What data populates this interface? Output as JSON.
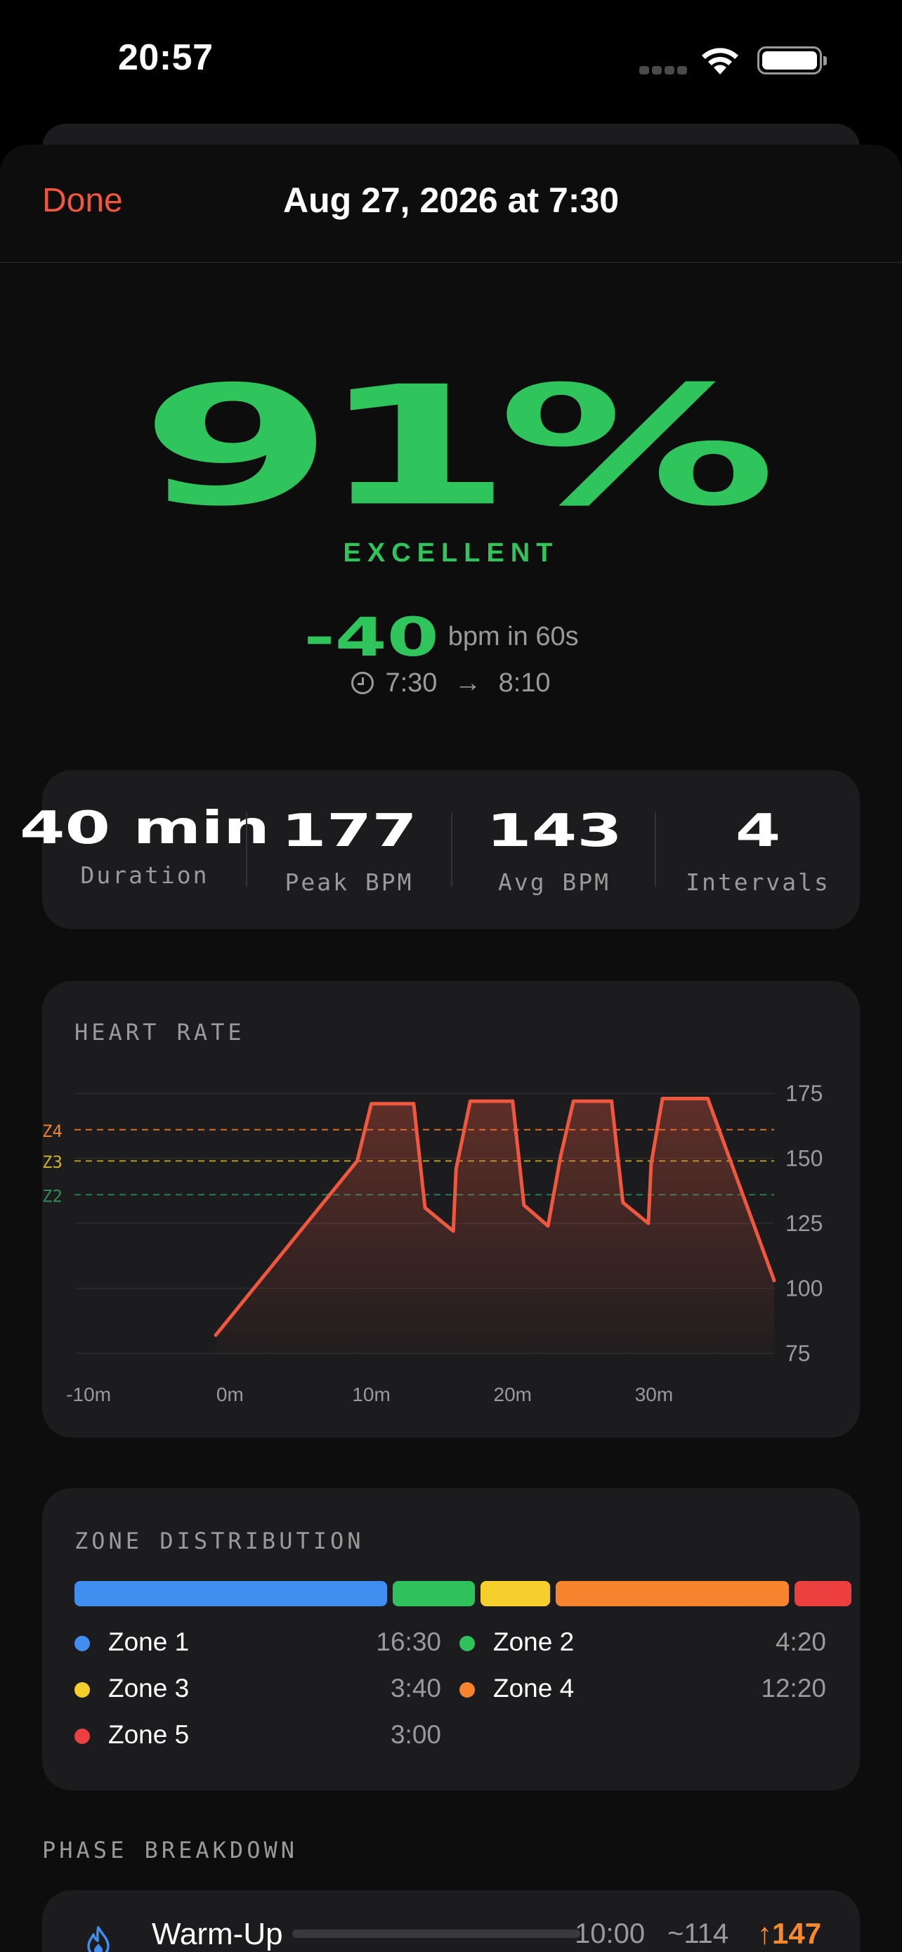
{
  "status_bar": {
    "time": "20:57"
  },
  "nav": {
    "done_label": "Done",
    "title": "Aug 27, 2026 at 7:30"
  },
  "summary": {
    "score": "91%",
    "grade": "EXCELLENT",
    "recovery_value": "-40",
    "recovery_unit": "bpm in 60s",
    "time_start": "7:30",
    "time_arrow": "→",
    "time_end": "8:10"
  },
  "stats": [
    {
      "value": "40 min",
      "label": "Duration"
    },
    {
      "value": "177",
      "label": "Peak BPM"
    },
    {
      "value": "143",
      "label": "Avg BPM"
    },
    {
      "value": "4",
      "label": "Intervals"
    }
  ],
  "heart_rate": {
    "title": "HEART RATE",
    "zone_labels": [
      "Z4",
      "Z3",
      "Z2"
    ],
    "y_ticks": [
      "175",
      "150",
      "125",
      "100",
      "75"
    ],
    "x_ticks": [
      "-10m",
      "0m",
      "10m",
      "20m",
      "30m"
    ],
    "colors": {
      "line": "#f0573f",
      "z4": "#f0822e",
      "z3": "#c9b02a",
      "z2": "#2f8a5a"
    }
  },
  "chart_data": {
    "type": "line",
    "title": "HEART RATE",
    "xlabel": "",
    "ylabel": "",
    "x_unit": "min",
    "ylim": [
      75,
      175
    ],
    "xlim": [
      -11,
      38.5
    ],
    "zones": [
      {
        "label": "Z4",
        "bpm": 161
      },
      {
        "label": "Z3",
        "bpm": 149
      },
      {
        "label": "Z2",
        "bpm": 136
      }
    ],
    "series": [
      {
        "x": [
          -1,
          9,
          10,
          13,
          13.8,
          15.8,
          16,
          17,
          20,
          20.8,
          22.5,
          23.4,
          24.3,
          27,
          27.8,
          29.6,
          29.8,
          30.6,
          33.8,
          38.5
        ],
        "y": [
          82,
          149,
          171,
          171,
          131,
          122,
          146,
          172,
          172,
          132,
          124,
          151,
          172,
          172,
          133,
          125,
          148,
          173,
          173,
          103
        ]
      }
    ]
  },
  "zones": {
    "title": "ZONE DISTRIBUTION",
    "items": [
      {
        "name": "Zone 1",
        "time": "16:30",
        "minutes": 16.5,
        "color": "#3f8ef0"
      },
      {
        "name": "Zone 2",
        "time": "4:20",
        "minutes": 4.33,
        "color": "#2fc25c"
      },
      {
        "name": "Zone 3",
        "time": "3:40",
        "minutes": 3.67,
        "color": "#f6cf2d"
      },
      {
        "name": "Zone 4",
        "time": "12:20",
        "minutes": 12.33,
        "color": "#f6842f"
      },
      {
        "name": "Zone 5",
        "time": "3:00",
        "minutes": 3.0,
        "color": "#ec3f3f"
      }
    ]
  },
  "phase": {
    "title": "PHASE BREAKDOWN",
    "items": [
      {
        "name": "Warm-Up",
        "duration": "10:00",
        "avg": "~114",
        "peak": "↑147",
        "icon": "flame-icon"
      }
    ]
  }
}
